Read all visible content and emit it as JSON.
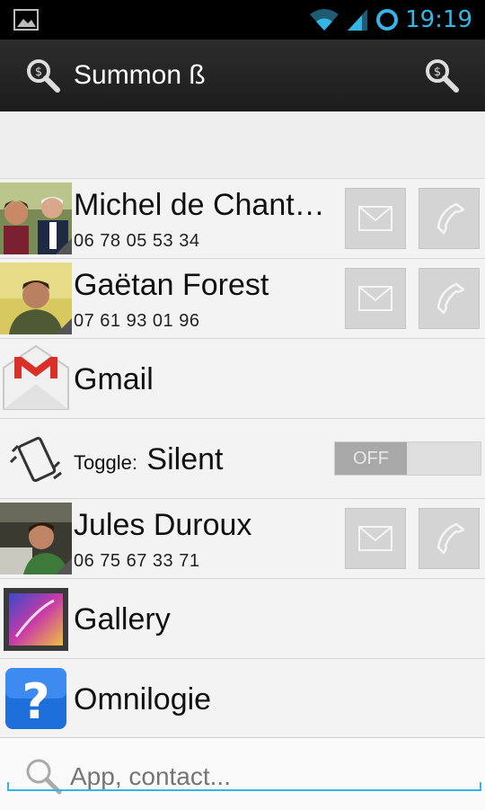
{
  "status_bar": {
    "time": "19:19"
  },
  "action_bar": {
    "title": "Summon ß"
  },
  "items": [
    {
      "type": "contact",
      "name": "Michel de Chant…",
      "phone": "06 78 05 53 34"
    },
    {
      "type": "contact",
      "name": "Gaëtan Forest",
      "phone": "07 61 93 01 96"
    },
    {
      "type": "app",
      "name": "Gmail"
    },
    {
      "type": "toggle",
      "prefix": "Toggle:",
      "name": "Silent",
      "state": "OFF"
    },
    {
      "type": "contact",
      "name": "Jules Duroux",
      "phone": "06 75 67 33 71"
    },
    {
      "type": "app",
      "name": "Gallery"
    },
    {
      "type": "app",
      "name": "Omnilogie"
    }
  ],
  "search": {
    "placeholder": "App, contact..."
  },
  "colors": {
    "accent": "#33b5e5",
    "action_bar": "#222222"
  },
  "icons": [
    "gallery-status-icon",
    "wifi-icon",
    "signal-icon",
    "sync-icon",
    "summon-search-icon",
    "mail-icon",
    "phone-icon",
    "silent-phone-icon",
    "search-icon"
  ]
}
